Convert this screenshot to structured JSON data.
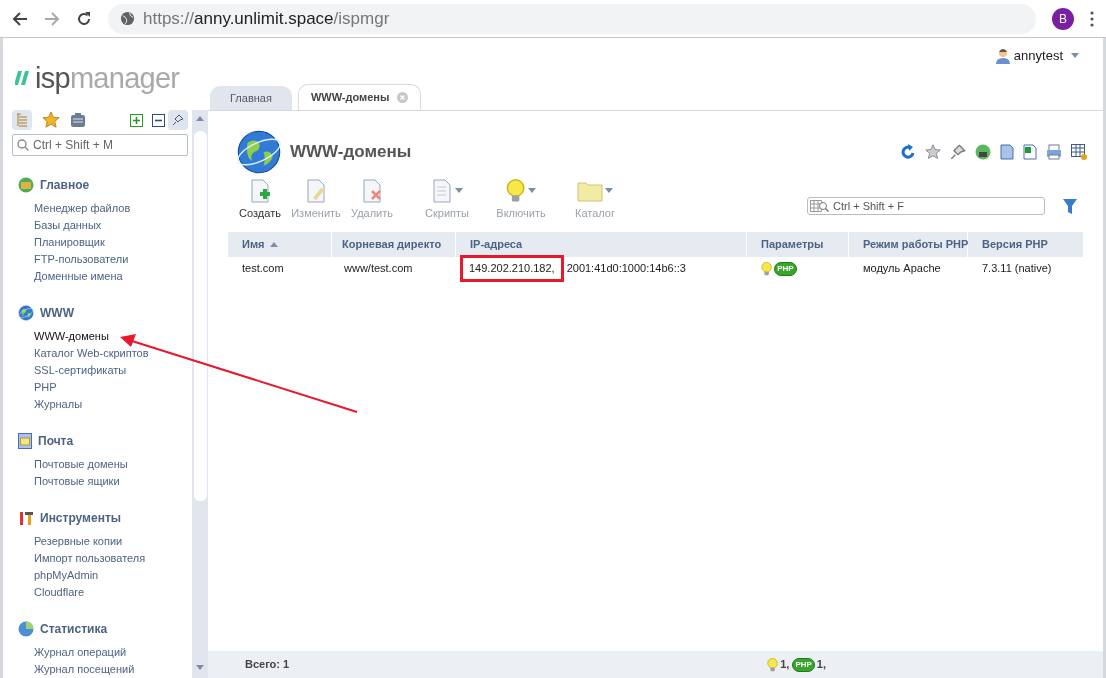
{
  "browser": {
    "url_scheme": "https://",
    "url_host": "anny.unlimit.space",
    "url_path": "/ispmgr",
    "profile_letter": "B"
  },
  "logo": {
    "part1": "isp",
    "part2": "manager"
  },
  "user": {
    "name": "annytest"
  },
  "sidebar": {
    "search": {
      "placeholder": "Ctrl + Shift + M"
    },
    "groups": [
      {
        "kind": "home",
        "title": "Главное",
        "items": [
          {
            "label": "Менеджер файлов",
            "selected": false
          },
          {
            "label": "Базы данных",
            "selected": false
          },
          {
            "label": "Планировщик",
            "selected": false
          },
          {
            "label": "FTP-пользователи",
            "selected": false
          },
          {
            "label": "Доменные имена",
            "selected": false
          }
        ]
      },
      {
        "kind": "globe",
        "title": "WWW",
        "items": [
          {
            "label": "WWW-домены",
            "selected": true
          },
          {
            "label": "Каталог Web-скриптов",
            "selected": false
          },
          {
            "label": "SSL-сертификаты",
            "selected": false
          },
          {
            "label": "PHP",
            "selected": false
          },
          {
            "label": "Журналы",
            "selected": false
          }
        ]
      },
      {
        "kind": "mail",
        "title": "Почта",
        "items": [
          {
            "label": "Почтовые домены",
            "selected": false
          },
          {
            "label": "Почтовые ящики",
            "selected": false
          }
        ]
      },
      {
        "kind": "tools",
        "title": "Инструменты",
        "items": [
          {
            "label": "Резервные копии",
            "selected": false
          },
          {
            "label": "Импорт пользователя",
            "selected": false
          },
          {
            "label": "phpMyAdmin",
            "selected": false
          },
          {
            "label": "Cloudflare",
            "selected": false
          }
        ]
      },
      {
        "kind": "chart",
        "title": "Статистика",
        "items": [
          {
            "label": "Журнал операций",
            "selected": false
          },
          {
            "label": "Журнал посещений",
            "selected": false
          }
        ]
      }
    ]
  },
  "tabs": [
    {
      "label": "Главная",
      "selected": false,
      "closable": false
    },
    {
      "label": "WWW-домены",
      "selected": true,
      "closable": true
    }
  ],
  "page": {
    "title": "WWW-домены"
  },
  "toolbar": [
    {
      "kind": "new",
      "label": "Создать",
      "disabled": false,
      "menu": false
    },
    {
      "kind": "edit",
      "label": "Изменить",
      "disabled": true,
      "menu": false
    },
    {
      "kind": "delete",
      "label": "Удалить",
      "disabled": true,
      "menu": false
    },
    {
      "kind": "scripts",
      "label": "Скрипты",
      "disabled": true,
      "menu": true
    },
    {
      "kind": "enable",
      "label": "Включить",
      "disabled": true,
      "menu": true
    },
    {
      "kind": "catalog",
      "label": "Каталог",
      "disabled": true,
      "menu": true
    }
  ],
  "filter": {
    "placeholder": "Ctrl + Shift + F"
  },
  "table": {
    "columns": [
      {
        "label": "Имя",
        "sorted": true
      },
      {
        "label": "Корневая директо",
        "sorted": false
      },
      {
        "label": "IP-адреса",
        "sorted": false
      },
      {
        "label": "Параметры",
        "sorted": false
      },
      {
        "label": "Режим работы PHP",
        "sorted": false
      },
      {
        "label": "Версия PHP",
        "sorted": false
      }
    ],
    "rows": [
      {
        "name": "test.com",
        "root": "www/test.com",
        "ips": [
          {
            "text": "149.202.210.182,",
            "highlighted": true
          },
          {
            "text": "2001:41d0:1000:14b6::3",
            "highlighted": false
          }
        ],
        "php_badge": "PHP",
        "php_mode": "модуль Apache",
        "php_version": "7.3.11 (native)"
      }
    ]
  },
  "footer": {
    "total": "Всего: 1",
    "bulb_count": "1,",
    "php_badge": "PHP",
    "php_count": "1,"
  },
  "annotations": [
    {
      "kind": "arrow",
      "color": "#e8192c"
    }
  ]
}
